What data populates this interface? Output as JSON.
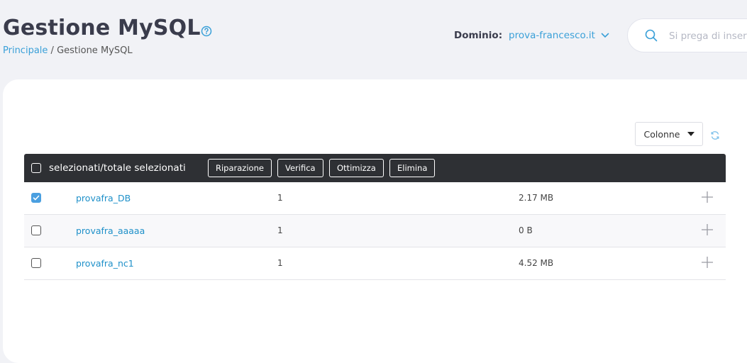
{
  "header": {
    "title": "Gestione MySQL",
    "breadcrumb": {
      "home": "Principale",
      "separator": " / ",
      "current": "Gestione MySQL"
    },
    "domain_label": "Dominio:",
    "domain_value": "prova-francesco.it",
    "search_placeholder": "Si prega di inserire"
  },
  "controls": {
    "columns_label": "Colonne"
  },
  "toolbar": {
    "select_label": "selezionati/totale selezionati",
    "buttons": [
      "Riparazione",
      "Verifica",
      "Ottimizza",
      "Elimina"
    ]
  },
  "rows": [
    {
      "name": "provafra_DB",
      "count": "1",
      "size": "2.17 MB",
      "checked": true
    },
    {
      "name": "provafra_aaaaa",
      "count": "1",
      "size": "0 B",
      "checked": false
    },
    {
      "name": "provafra_nc1",
      "count": "1",
      "size": "4.52 MB",
      "checked": false
    }
  ],
  "colors": {
    "accent": "#3aa0d8",
    "toolbar_bg": "#2e3034",
    "checkbox_checked": "#4a9fe0"
  },
  "icons": [
    "help-icon",
    "chevron-down-icon",
    "search-icon",
    "caret-down-icon",
    "refresh-icon",
    "plus-icon",
    "checkmark-icon"
  ]
}
